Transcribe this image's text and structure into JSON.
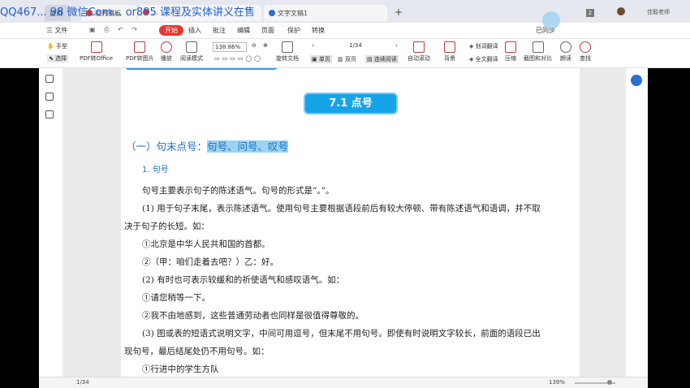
{
  "watermark": "QQ467... 98 微信Com... or895 课程及实体讲义在售",
  "tabs": {
    "home": "首页",
    "t1": "稻壳模板",
    "t2": "...",
    "t3": "文字文稿1"
  },
  "badge": "2",
  "user": "佳毅老师",
  "menu": {
    "file": "三 文件",
    "start": "开始",
    "items": [
      "插入",
      "批注",
      "编辑",
      "页面",
      "保护",
      "转换"
    ],
    "sync": "已同步"
  },
  "toolbar": {
    "hand": "手型",
    "select": "选择",
    "pdf_office": "PDF转Office",
    "pdf_image": "PDF转图片",
    "play": "播放",
    "read_mode": "阅读模式",
    "zoom_value": "138.86%",
    "rotate": "旋转文档",
    "page_value": "1/34",
    "single": "单页",
    "double": "双页",
    "continuous": "连续阅读",
    "auto_scroll": "自动滚动",
    "background": "背景",
    "word_translate": "划词翻译",
    "full_translate": "全文翻译",
    "compress": "压缩",
    "screenshot": "截图和对比",
    "read_aloud": "朗读",
    "find": "查找"
  },
  "document": {
    "heading": "7.1 点号",
    "section_prefix": "（一）句末点号：",
    "section_highlight": "句号、问号、叹号",
    "subsection": "1. 句号",
    "faint_text": "(隐约可见文字)",
    "lines": [
      "句号主要表示句子的陈述语气。句号的形式是“。”。",
      "(1) 用于句子末尾，表示陈述语气。使用句号主要根据语段前后有较大停顿、带有陈述语气和语调，并不取",
      "决于句子的长短。如：",
      "①北京是中华人民共和国的首都。",
      "②（甲：咱们走着去吧？）乙：好。",
      "(2) 有时也可表示较缓和的祈使语气和感叹语气。如：",
      "①请您稍等一下。",
      "②我不由地感到，这些普通劳动者也同样是很值得尊敬的。",
      "(3) 图或表的短语式说明文字，中间可用逗号，但末尾不用句号。即使有时说明文字较长，前面的语段已出",
      "现句号，最后结尾处仍不用句号。如：",
      "①行进中的学生方队"
    ]
  },
  "status": {
    "page": "1/34",
    "zoom": "139%"
  },
  "colors": {
    "accent_red": "#e8372c",
    "heading_blue": "#16a3e8",
    "section_blue": "#1a6fc4",
    "highlight": "#9ad3f3"
  }
}
